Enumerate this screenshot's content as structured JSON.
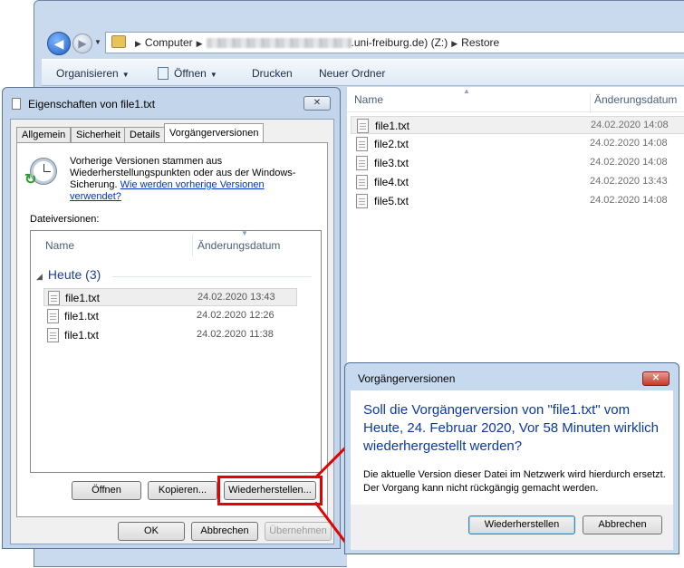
{
  "explorer": {
    "address": {
      "root": "Computer",
      "server_suffix": ".uni-freiburg.de) (Z:)",
      "current": "Restore"
    },
    "toolbar": {
      "organize": "Organisieren",
      "open": "Öffnen",
      "print": "Drucken",
      "new_folder": "Neuer Ordner"
    },
    "columns": {
      "name": "Name",
      "date": "Änderungsdatum"
    },
    "files": [
      {
        "name": "file1.txt",
        "date": "24.02.2020 14:08"
      },
      {
        "name": "file2.txt",
        "date": "24.02.2020 14:08"
      },
      {
        "name": "file3.txt",
        "date": "24.02.2020 14:08"
      },
      {
        "name": "file4.txt",
        "date": "24.02.2020 13:43"
      },
      {
        "name": "file5.txt",
        "date": "24.02.2020 14:08"
      }
    ]
  },
  "properties": {
    "title": "Eigenschaften von file1.txt",
    "close": "✕",
    "tabs": [
      "Allgemein",
      "Sicherheit",
      "Details",
      "Vorgängerversionen"
    ],
    "intro_text": "Vorherige Versionen stammen aus Wiederherstellungspunkten oder aus der Windows-Sicherung.",
    "intro_link": "Wie werden vorherige Versionen verwendet?",
    "versions_label": "Dateiversionen:",
    "columns": {
      "name": "Name",
      "date": "Änderungsdatum"
    },
    "group": "Heute (3)",
    "versions": [
      {
        "name": "file1.txt",
        "date": "24.02.2020 13:43"
      },
      {
        "name": "file1.txt",
        "date": "24.02.2020 12:26"
      },
      {
        "name": "file1.txt",
        "date": "24.02.2020 11:38"
      }
    ],
    "buttons": {
      "open": "Öffnen",
      "copy": "Kopieren...",
      "restore": "Wiederherstellen...",
      "ok": "OK",
      "cancel": "Abbrechen",
      "apply": "Übernehmen"
    }
  },
  "confirm": {
    "title": "Vorgängerversionen",
    "close": "✕",
    "question": "Soll die Vorgängerversion von \"file1.txt\" vom Heute, 24. Februar 2020, Vor 58 Minuten wirklich wiederhergestellt werden?",
    "detail": "Die aktuelle Version dieser Datei im Netzwerk wird hierdurch ersetzt. Der Vorgang kann nicht rückgängig gemacht werden.",
    "buttons": {
      "restore": "Wiederherstellen",
      "cancel": "Abbrechen"
    }
  },
  "colors": {
    "highlight": "#e60000",
    "link": "#0033cc",
    "heading_blue": "#0b3a9e"
  }
}
